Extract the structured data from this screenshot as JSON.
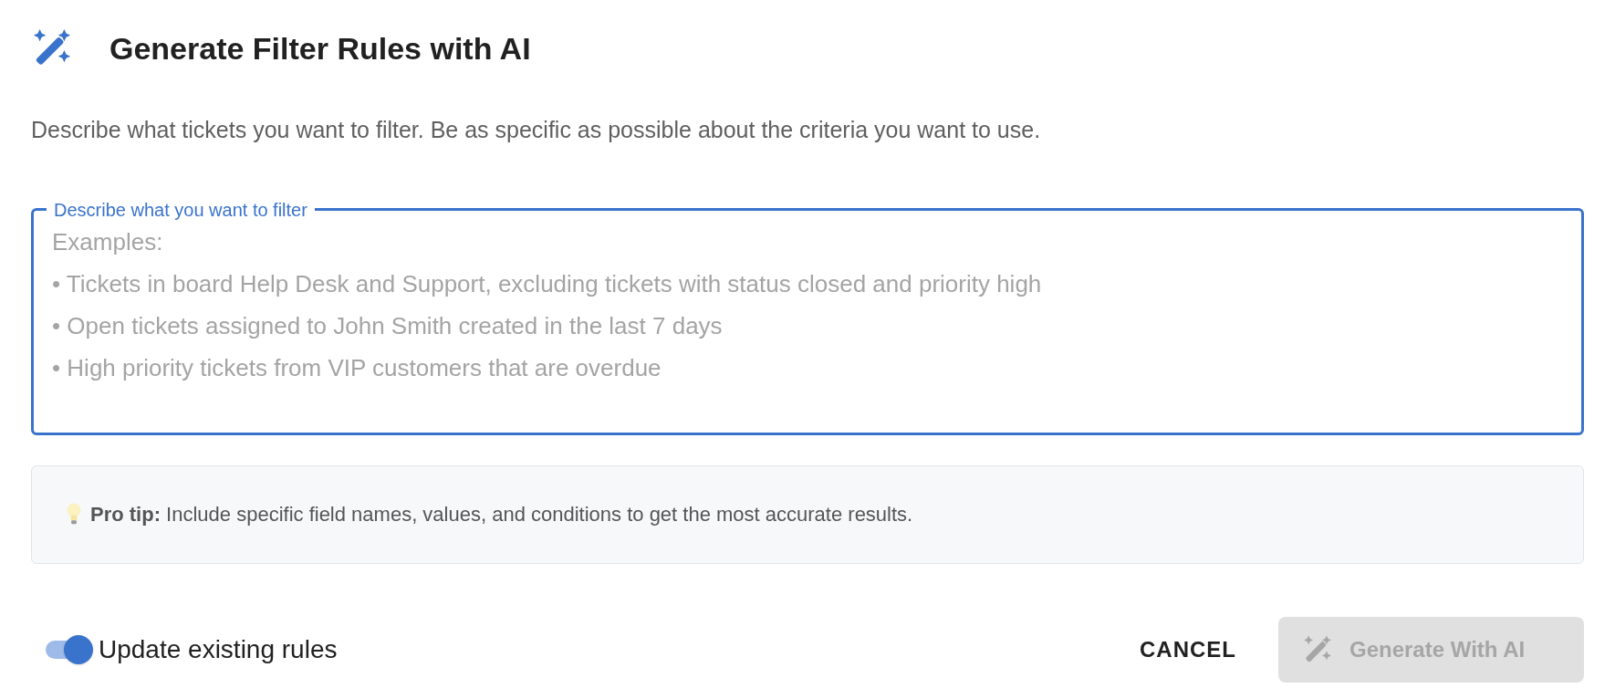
{
  "dialog": {
    "title": "Generate Filter Rules with AI",
    "description": "Describe what tickets you want to filter. Be as specific as possible about the criteria you want to use."
  },
  "query_field": {
    "label": "Describe what you want to filter",
    "placeholder": "Examples:\n• Tickets in board Help Desk and Support, excluding tickets with status closed and priority high\n• Open tickets assigned to John Smith created in the last 7 days\n• High priority tickets from VIP customers that are overdue",
    "focused": true
  },
  "tip": {
    "text": "**Pro tip:** Include specific field names, values, and conditions to get the most accurate results."
  },
  "update_toggle": {
    "label": "Update existing rules",
    "on": true
  },
  "buttons": [
    {
      "kind": "text",
      "label": "CANCEL",
      "disabled": false
    },
    {
      "kind": "ai",
      "label": "Generate With AI",
      "disabled": true
    }
  ]
}
